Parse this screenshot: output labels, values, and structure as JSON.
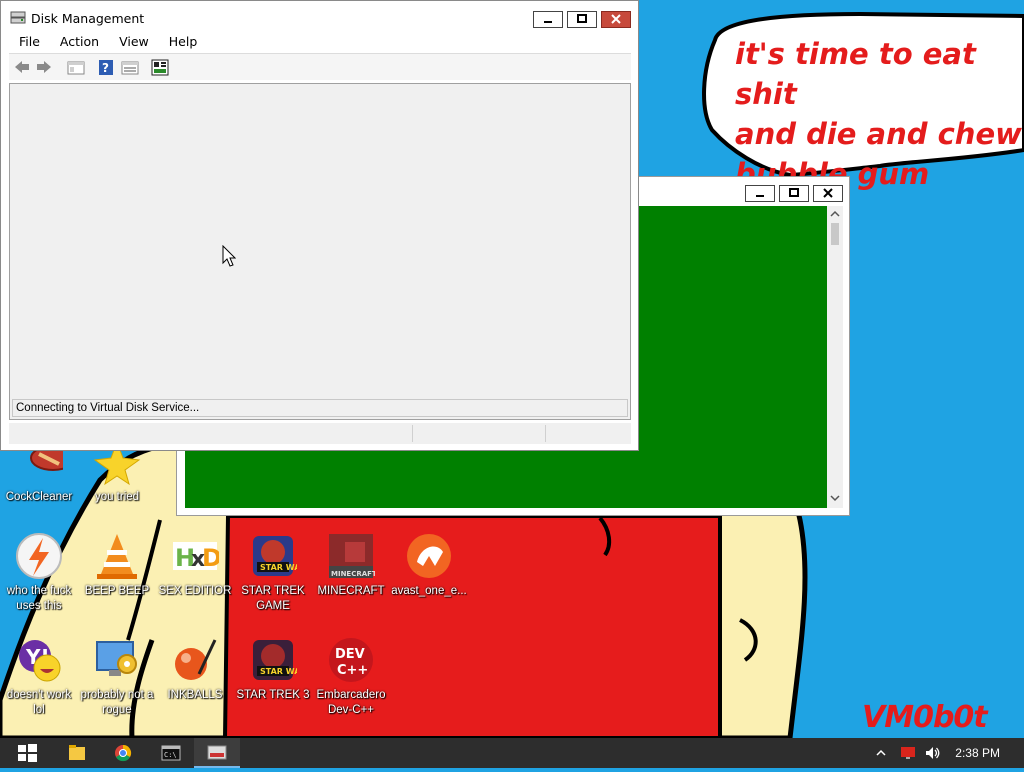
{
  "wallpaper": {
    "speech_lines": [
      "it's time to eat shit",
      "and die and chew",
      "bubble gum"
    ],
    "signature": "VM0b0t",
    "colors": {
      "sky": "#1fa3e3",
      "skin": "#fbf0b3",
      "shirt": "#e61c1c",
      "outline": "#000000"
    }
  },
  "disk_management": {
    "title": "Disk Management",
    "menu": [
      "File",
      "Action",
      "View",
      "Help"
    ],
    "toolbar_icons": [
      "back-arrow-icon",
      "forward-arrow-icon",
      "console-tree-icon",
      "help-icon",
      "properties-icon",
      "settings-icon"
    ],
    "status_text": "Connecting to Virtual Disk Service..."
  },
  "console_window": {
    "background": "#008000"
  },
  "desktop_icons": [
    {
      "id": "cockcleaner",
      "label": "CockCleaner"
    },
    {
      "id": "you-tried",
      "label": "you tried"
    },
    {
      "id": "avast-flash",
      "label": "who the fuck uses this"
    },
    {
      "id": "vlc",
      "label": "BEEP BEEP"
    },
    {
      "id": "hxd",
      "label": "SEX EDITIOR"
    },
    {
      "id": "star-trek-game",
      "label": "STAR TREK GAME"
    },
    {
      "id": "minecraft",
      "label": "MINECRAFT"
    },
    {
      "id": "avast-one",
      "label": "avast_one_e..."
    },
    {
      "id": "yahoo",
      "label": "doesn't work lol"
    },
    {
      "id": "rogue",
      "label": "probably not a rogue"
    },
    {
      "id": "inkballs",
      "label": "INKBALLS"
    },
    {
      "id": "star-trek-3",
      "label": "STAR TREK 3"
    },
    {
      "id": "devcpp",
      "label": "Embarcadero Dev-C++"
    }
  ],
  "taskbar": {
    "items": [
      "start-button",
      "file-explorer",
      "chrome",
      "command-prompt",
      "disk-management"
    ],
    "clock": "2:38 PM"
  }
}
